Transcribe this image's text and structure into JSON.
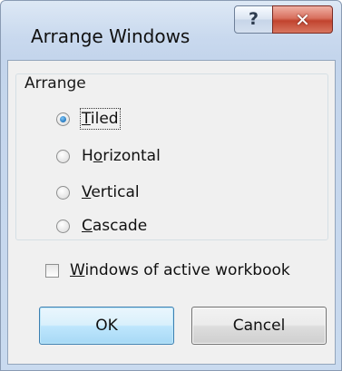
{
  "window": {
    "title": "Arrange Windows",
    "help_glyph": "?",
    "close_glyph": "✕"
  },
  "arrange": {
    "group_label": "Arrange",
    "options": [
      {
        "mnemonic": "T",
        "rest": "iled",
        "checked": true
      },
      {
        "pre": "H",
        "mnemonic": "o",
        "rest": "rizontal",
        "checked": false
      },
      {
        "mnemonic": "V",
        "rest": "ertical",
        "checked": false
      },
      {
        "mnemonic": "C",
        "rest": "ascade",
        "checked": false
      }
    ]
  },
  "active_workbook": {
    "mnemonic": "W",
    "rest": "indows of active workbook",
    "checked": false
  },
  "buttons": {
    "ok_label": "OK",
    "cancel_label": "Cancel"
  },
  "colors": {
    "radio_selected": "#1a6fb8",
    "close_button": "#c1432e",
    "default_button_border": "#3c7fb1"
  }
}
